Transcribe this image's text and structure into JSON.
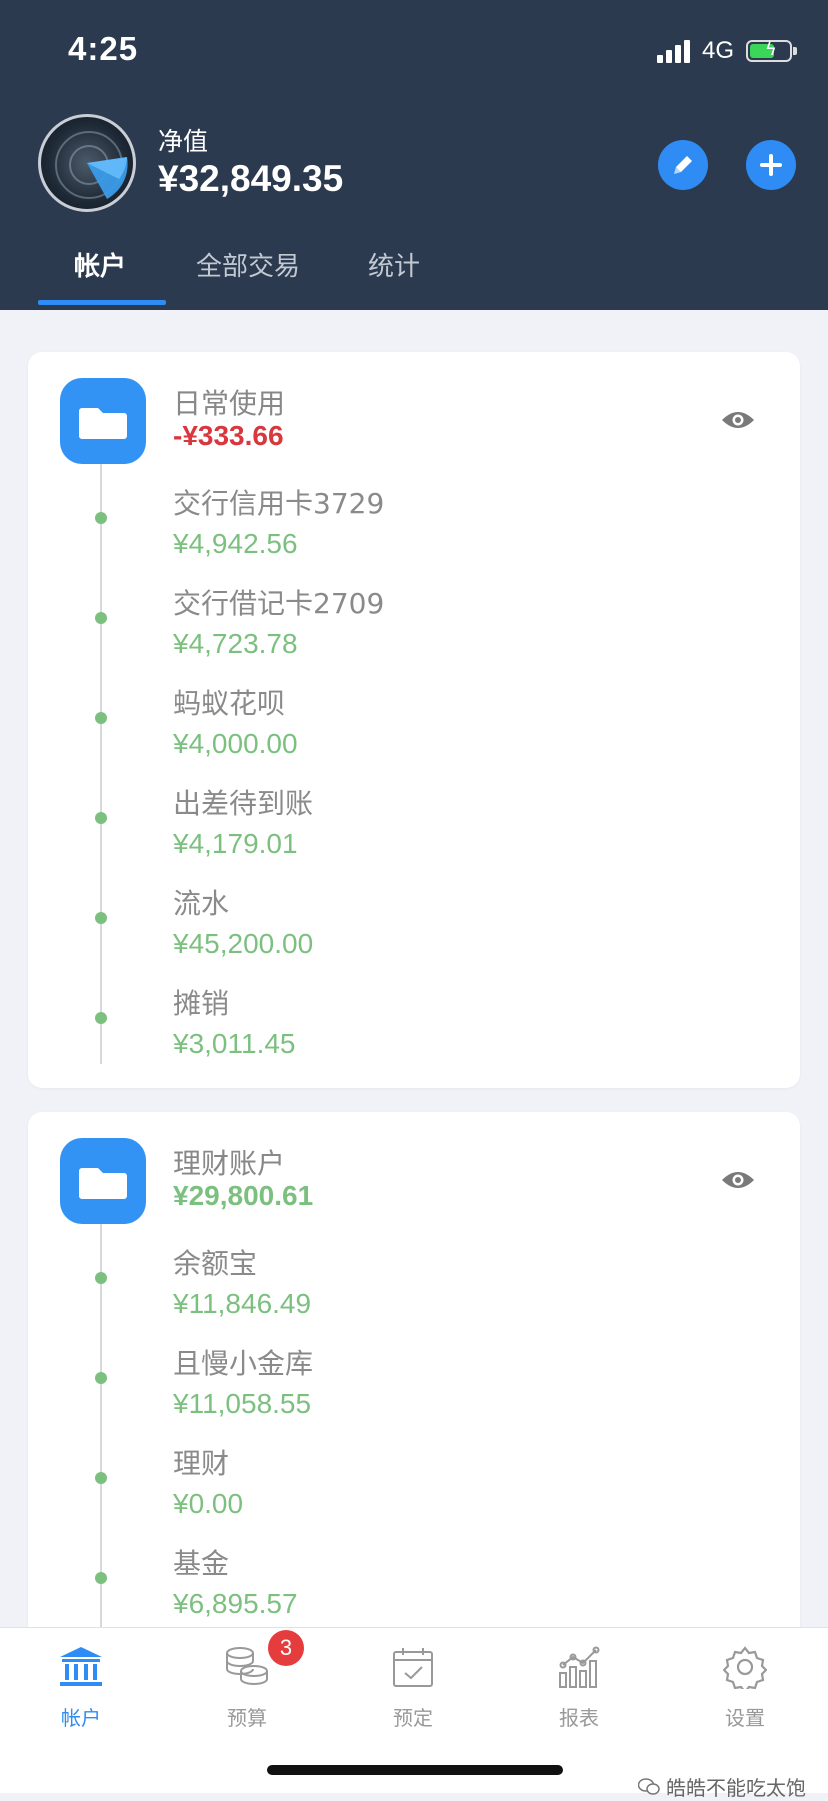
{
  "status_bar": {
    "time": "4:25",
    "network": "4G"
  },
  "header": {
    "net_worth_label": "净值",
    "net_worth_value": "¥32,849.35",
    "tabs": [
      {
        "label": "帐户",
        "active": true
      },
      {
        "label": "全部交易",
        "active": false
      },
      {
        "label": "统计",
        "active": false
      }
    ]
  },
  "groups": [
    {
      "name": "日常使用",
      "total": "-¥333.66",
      "total_color": "#d9363e",
      "items": [
        {
          "name": "交行信用卡3729",
          "amount": "¥4,942.56"
        },
        {
          "name": "交行借记卡2709",
          "amount": "¥4,723.78"
        },
        {
          "name": "蚂蚁花呗",
          "amount": "¥4,000.00"
        },
        {
          "name": "出差待到账",
          "amount": "¥4,179.01"
        },
        {
          "name": "流水",
          "amount": "¥45,200.00"
        },
        {
          "name": "摊销",
          "amount": "¥3,011.45"
        }
      ]
    },
    {
      "name": "理财账户",
      "total": "¥29,800.61",
      "total_color": "#7cc07f",
      "items": [
        {
          "name": "余额宝",
          "amount": "¥11,846.49"
        },
        {
          "name": "且慢小金库",
          "amount": "¥11,058.55"
        },
        {
          "name": "理财",
          "amount": "¥0.00"
        },
        {
          "name": "基金",
          "amount": "¥6,895.57"
        }
      ]
    }
  ],
  "tabbar": {
    "items": [
      {
        "label": "帐户",
        "icon": "bank-icon",
        "active": true
      },
      {
        "label": "预算",
        "icon": "coins-icon",
        "active": false
      },
      {
        "label": "预定",
        "icon": "calendar-check-icon",
        "active": false
      },
      {
        "label": "报表",
        "icon": "chart-icon",
        "active": false
      },
      {
        "label": "设置",
        "icon": "gear-icon",
        "active": false
      }
    ],
    "budget_badge": "3"
  },
  "watermark": "皓皓不能吃太饱",
  "colors": {
    "accent": "#2f8cf4",
    "header_bg": "#2b3a4f",
    "positive": "#7cc07f",
    "negative": "#d9363e"
  }
}
